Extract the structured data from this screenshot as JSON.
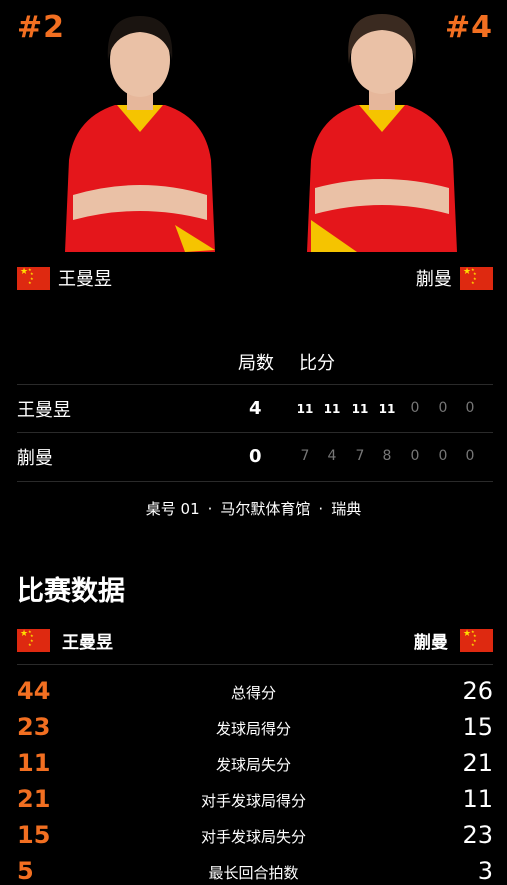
{
  "header": {
    "left_seed": "#2",
    "right_seed": "#4"
  },
  "colors": {
    "accent": "#f26f21",
    "flag_red": "#de2910",
    "flag_star": "#ffde00",
    "jersey": "#e4161b"
  },
  "players": {
    "left_name": "王曼昱",
    "right_name": "蒯曼"
  },
  "scoreboard": {
    "games_label": "局数",
    "points_label": "比分",
    "rows": [
      {
        "name": "王曼昱",
        "games": "4",
        "points": [
          "11",
          "11",
          "11",
          "11",
          "0",
          "0",
          "0"
        ]
      },
      {
        "name": "蒯曼",
        "games": "0",
        "points": [
          "7",
          "4",
          "7",
          "8",
          "0",
          "0",
          "0"
        ]
      }
    ]
  },
  "venue": {
    "table": "桌号 01",
    "dot": "·",
    "place": "马尔默体育馆",
    "country": "瑞典"
  },
  "stats": {
    "title": "比赛数据",
    "left_name": "王曼昱",
    "right_name": "蒯曼",
    "rows": [
      {
        "left": "44",
        "label": "总得分",
        "right": "26"
      },
      {
        "left": "23",
        "label": "发球局得分",
        "right": "15"
      },
      {
        "left": "11",
        "label": "发球局失分",
        "right": "21"
      },
      {
        "left": "21",
        "label": "对手发球局得分",
        "right": "11"
      },
      {
        "left": "15",
        "label": "对手发球局失分",
        "right": "23"
      },
      {
        "left": "5",
        "label": "最长回合拍数",
        "right": "3"
      }
    ]
  }
}
